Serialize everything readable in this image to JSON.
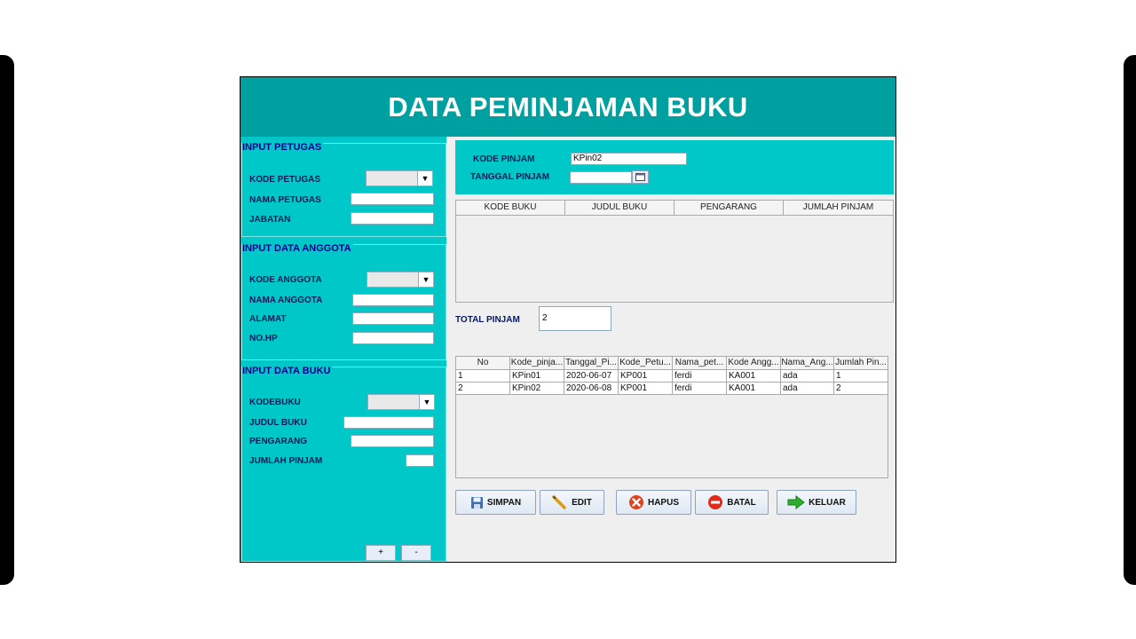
{
  "window": {
    "title": "DATA PEMINJAMAN BUKU"
  },
  "petugas": {
    "group_title": "INPUT PETUGAS",
    "kode_label": "KODE PETUGAS",
    "nama_label": "NAMA PETUGAS",
    "jabatan_label": "JABATAN"
  },
  "anggota": {
    "group_title": "INPUT DATA ANGGOTA",
    "kode_label": "KODE ANGGOTA",
    "nama_label": "NAMA ANGGOTA",
    "alamat_label": "ALAMAT",
    "hp_label": "NO.HP"
  },
  "buku": {
    "group_title": "INPUT DATA BUKU",
    "kode_label": "KODEBUKU",
    "judul_label": "JUDUL BUKU",
    "pengarang_label": "PENGARANG",
    "jumlah_label": "JUMLAH PINJAM",
    "add_label": "+",
    "remove_label": "-"
  },
  "pinjam": {
    "kode_label": "KODE PINJAM",
    "kode_value": "KPin02",
    "tanggal_label": "TANGGAL PINJAM",
    "tanggal_value": ""
  },
  "detail_table": {
    "columns": [
      "KODE BUKU",
      "JUDUL BUKU",
      "PENGARANG",
      "JUMLAH PINJAM"
    ]
  },
  "total": {
    "label": "TOTAL PINJAM",
    "value": "2"
  },
  "history_table": {
    "columns": [
      "No",
      "Kode_pinja...",
      "Tanggal_Pi...",
      "Kode_Petu...",
      "Nama_pet...",
      "Kode Angg...",
      "Nama_Ang...",
      "Jumlah Pin..."
    ],
    "rows": [
      [
        "1",
        "KPin01",
        "2020-06-07",
        "KP001",
        "ferdi",
        "KA001",
        "ada",
        "1"
      ],
      [
        "2",
        "KPin02",
        "2020-06-08",
        "KP001",
        "ferdi",
        "KA001",
        "ada",
        "2"
      ]
    ]
  },
  "buttons": {
    "simpan": "SIMPAN",
    "edit": "EDIT",
    "hapus": "HAPUS",
    "batal": "BATAL",
    "keluar": "KELUAR"
  }
}
